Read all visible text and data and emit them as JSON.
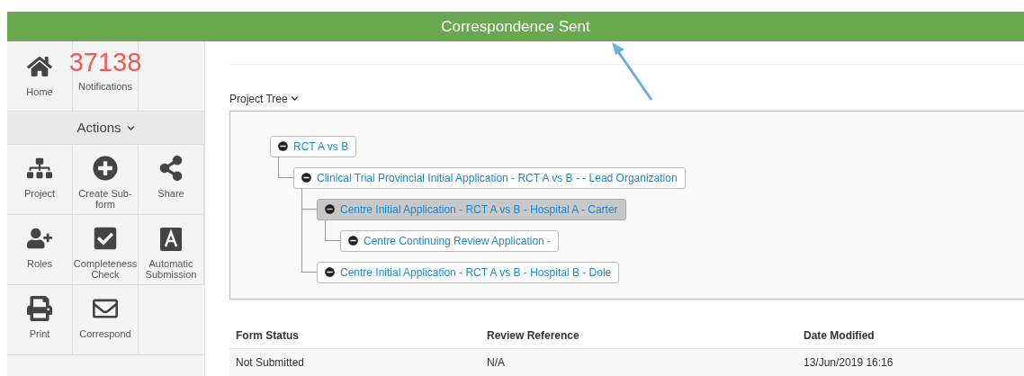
{
  "banner": {
    "title": "Correspondence Sent"
  },
  "sidebar": {
    "top_items": [
      {
        "kind": "icon",
        "label": "Home"
      },
      {
        "kind": "count",
        "count": "37138",
        "label": "Notifications"
      }
    ],
    "actions_header": "Actions",
    "actions": [
      {
        "label": "Project"
      },
      {
        "label": "Create Sub-form"
      },
      {
        "label": "Share"
      },
      {
        "label": "Roles"
      },
      {
        "label": "Completeness Check"
      },
      {
        "label": "Automatic Submission"
      },
      {
        "label": "Print"
      },
      {
        "label": "Correspond"
      }
    ]
  },
  "project_tree": {
    "title": "Project Tree",
    "nodes": [
      {
        "label": "RCT A vs B",
        "selected": false,
        "children": [
          {
            "label": "Clinical Trial Provincial Initial Application - RCT A vs B - - Lead Organization",
            "selected": false,
            "children": [
              {
                "label": "Centre Initial Application - RCT A vs B - Hospital A - Carter",
                "selected": true,
                "children": [
                  {
                    "label": "Centre Continuing Review Application -",
                    "selected": false
                  }
                ]
              },
              {
                "label": "Centre Initial Application - RCT A vs B - Hospital B - Dole",
                "selected": false
              }
            ]
          }
        ]
      }
    ]
  },
  "table": {
    "columns": [
      "Form Status",
      "Review Reference",
      "Date Modified"
    ],
    "rows": [
      [
        "Not Submitted",
        "N/A",
        "13/Jun/2019 16:16"
      ]
    ]
  }
}
